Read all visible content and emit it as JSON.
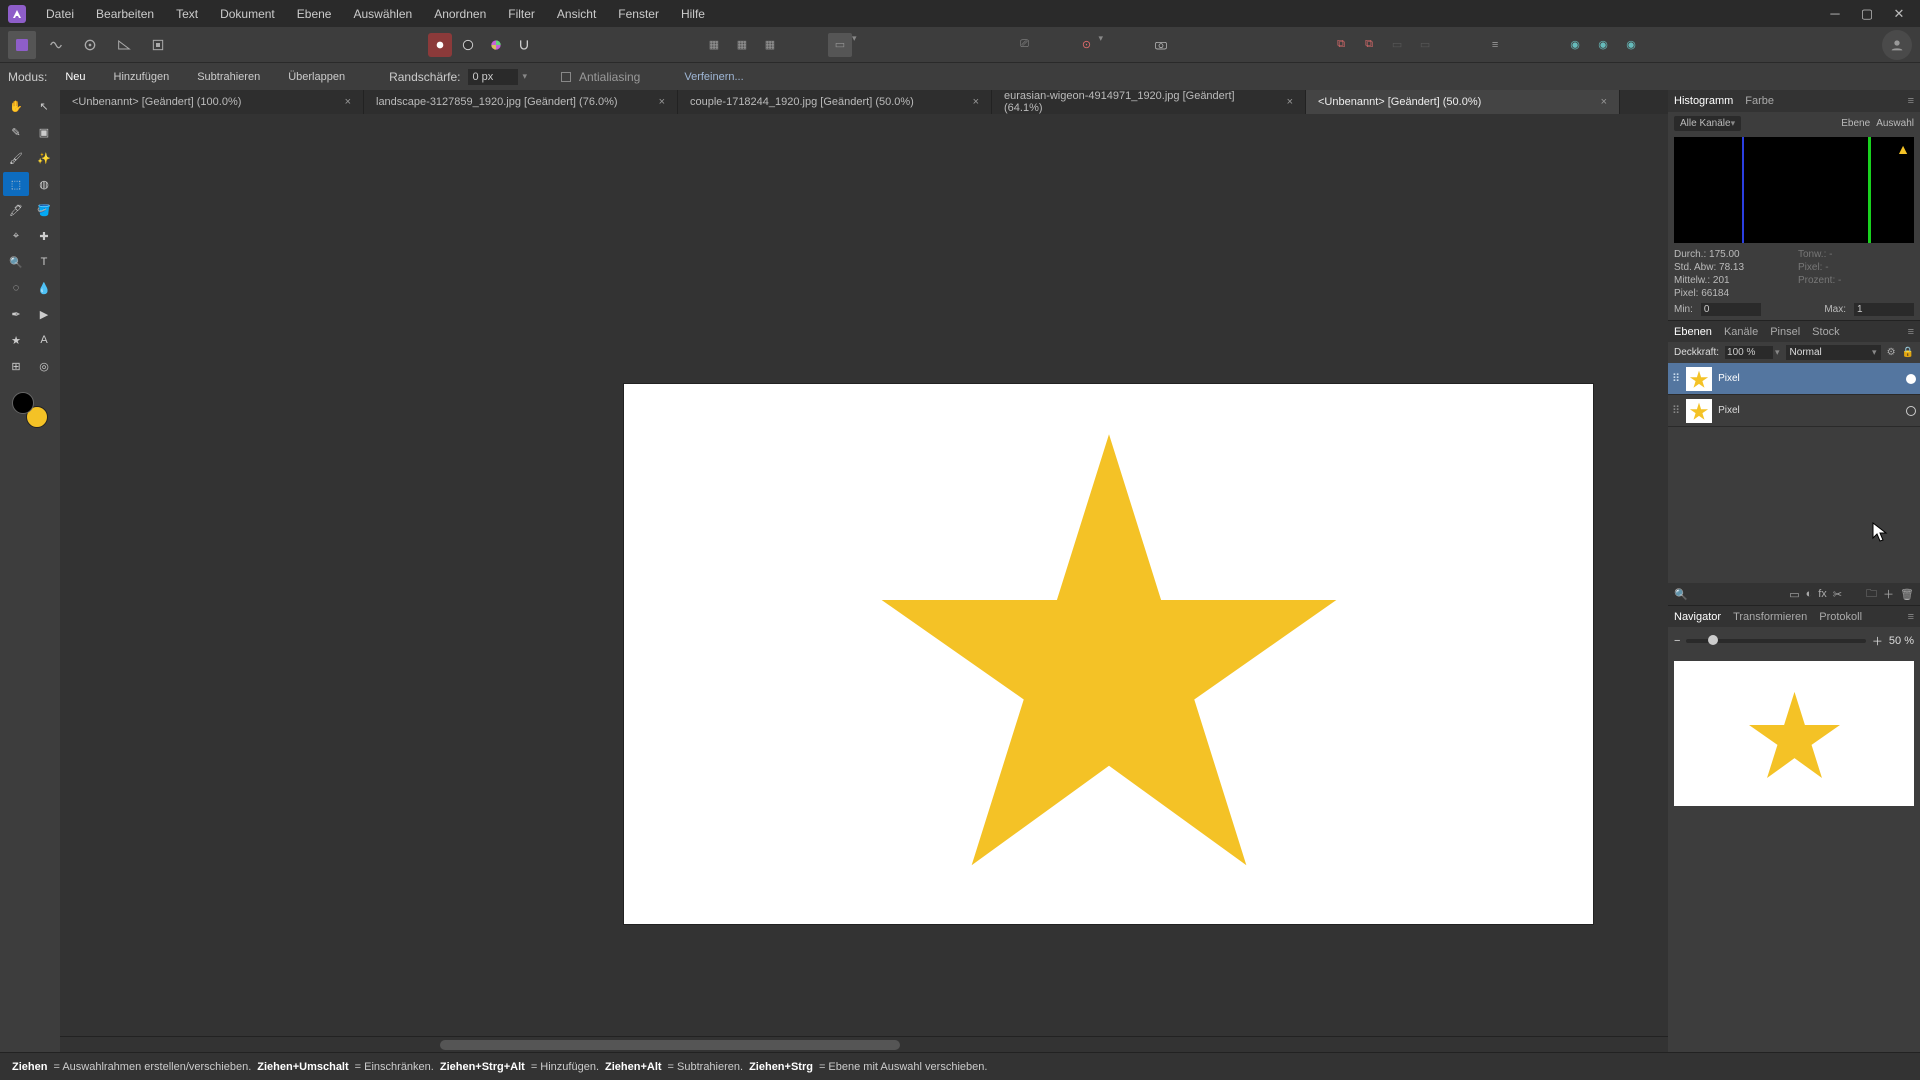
{
  "menubar": {
    "items": [
      "Datei",
      "Bearbeiten",
      "Text",
      "Dokument",
      "Ebene",
      "Auswählen",
      "Anordnen",
      "Filter",
      "Ansicht",
      "Fenster",
      "Hilfe"
    ]
  },
  "context_toolbar": {
    "modus_label": "Modus:",
    "new_label": "Neu",
    "add_label": "Hinzufügen",
    "subtract_label": "Subtrahieren",
    "overlap_label": "Überlappen",
    "feather_label": "Randschärfe:",
    "feather_value": "0 px",
    "antialias_label": "Antialiasing",
    "refine_label": "Verfeinern..."
  },
  "tabs": [
    {
      "label": "<Unbenannt> [Geändert] (100.0%)"
    },
    {
      "label": "landscape-3127859_1920.jpg [Geändert] (76.0%)"
    },
    {
      "label": "couple-1718244_1920.jpg [Geändert] (50.0%)"
    },
    {
      "label": "eurasian-wigeon-4914971_1920.jpg [Geändert] (64.1%)"
    },
    {
      "label": "<Unbenannt> [Geändert] (50.0%)"
    }
  ],
  "histogram_panel": {
    "tab_histogram": "Histogramm",
    "tab_color": "Farbe",
    "channels": "Alle Kanäle",
    "btn_layer": "Ebene",
    "btn_selection": "Auswahl",
    "stats": {
      "mean_label": "Durch.:",
      "mean": "175.00",
      "sd_label": "Std. Abw:",
      "sd": "78.13",
      "median_label": "Mittelw.:",
      "median": "201",
      "pixels_label": "Pixel:",
      "pixels": "66184",
      "tones_label": "Tonw.:",
      "tones": "-",
      "pixelr_label": "Pixel:",
      "pixelr": "-",
      "percent_label": "Prozent:",
      "percent": "-"
    },
    "min_label": "Min:",
    "min": "0",
    "max_label": "Max:",
    "max": "1"
  },
  "layers_panel": {
    "tab_layers": "Ebenen",
    "tab_channels": "Kanäle",
    "tab_brushes": "Pinsel",
    "tab_stock": "Stock",
    "opacity_label": "Deckkraft:",
    "opacity_value": "100 %",
    "blend_mode": "Normal",
    "layers": [
      {
        "name": "Pixel",
        "selected": true
      },
      {
        "name": "Pixel",
        "selected": false
      }
    ]
  },
  "navigator_panel": {
    "tab_navigator": "Navigator",
    "tab_transform": "Transformieren",
    "tab_history": "Protokoll",
    "zoom": "50 %"
  },
  "statusbar": {
    "s1a": "Ziehen",
    "s1b": " = Auswahlrahmen erstellen/verschieben. ",
    "s2a": "Ziehen+Umschalt",
    "s2b": " = Einschränken. ",
    "s3a": "Ziehen+Strg+Alt",
    "s3b": " = Hinzufügen. ",
    "s4a": "Ziehen+Alt",
    "s4b": " = Subtrahieren. ",
    "s5a": "Ziehen+Strg",
    "s5b": " = Ebene mit Auswahl verschieben."
  },
  "colors": {
    "star": "#f4c226"
  }
}
